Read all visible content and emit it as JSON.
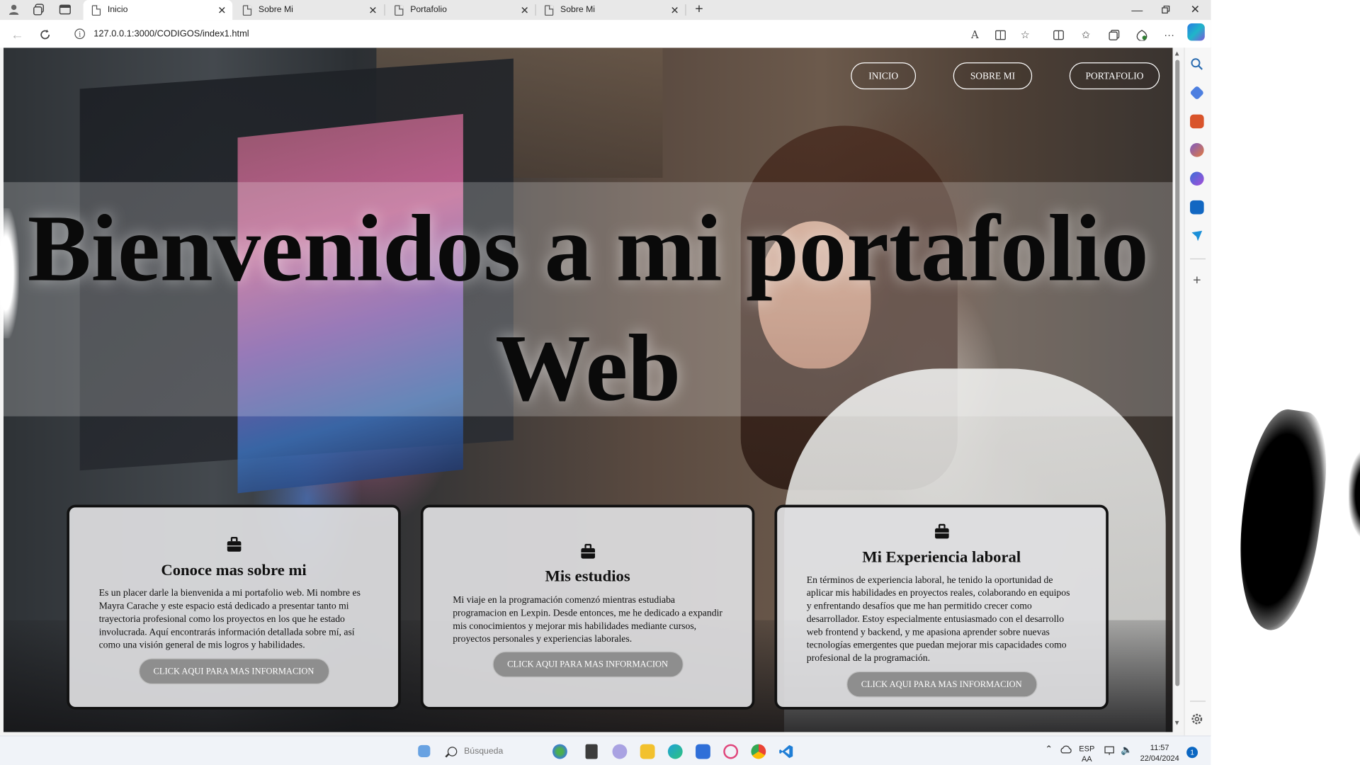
{
  "browser": {
    "tabs": [
      {
        "title": "Inicio",
        "active": true
      },
      {
        "title": "Sobre Mi",
        "active": false
      },
      {
        "title": "Portafolio",
        "active": false
      },
      {
        "title": "Sobre Mi",
        "active": false
      }
    ],
    "url": "127.0.0.1:3000/CODIGOS/index1.html",
    "reader_label": "A"
  },
  "page": {
    "nav": {
      "inicio": "INICIO",
      "sobre_mi": "SOBRE MI",
      "portafolio": "PORTAFOLIO"
    },
    "hero_title_line1": "Bienvenidos a mi portafolio",
    "hero_title_line2": "Web",
    "cards": [
      {
        "title": "Conoce mas sobre mi",
        "text": "Es un placer darle la bienvenida a mi portafolio web. Mi nombre es Mayra Carache y este espacio está dedicado a presentar tanto mi trayectoria profesional como los proyectos en los que he estado involucrada. Aquí encontrarás información detallada sobre mí, así como una visión general de mis logros y habilidades.",
        "button": "CLICK AQUI PARA MAS INFORMACION"
      },
      {
        "title": "Mis estudios",
        "text": "Mi viaje en la programación comenzó mientras estudiaba programacion en Lexpin. Desde entonces, me he dedicado a expandir mis conocimientos y mejorar mis habilidades mediante cursos, proyectos personales y experiencias laborales.",
        "button": "CLICK AQUI PARA MAS INFORMACION"
      },
      {
        "title": "Mi Experiencia laboral",
        "text": "En términos de experiencia laboral, he tenido la oportunidad de aplicar mis habilidades en proyectos reales, colaborando en equipos y enfrentando desafíos que me han permitido crecer como desarrollador. Estoy especialmente entusiasmado con el desarrollo web frontend y backend, y me apasiona aprender sobre nuevas tecnologías emergentes que puedan mejorar mis capacidades como profesional de la programación.",
        "button": "CLICK AQUI PARA MAS INFORMACION"
      }
    ]
  },
  "taskbar": {
    "search_placeholder": "Búsqueda",
    "lang_line1": "ESP",
    "lang_line2": "AA",
    "time": "11:57",
    "date": "22/04/2024",
    "notification_count": "1"
  },
  "colors": {
    "card_bg": "#dedee0",
    "button_bg": "#8e8e8e",
    "title_color": "#0a0a0a"
  }
}
